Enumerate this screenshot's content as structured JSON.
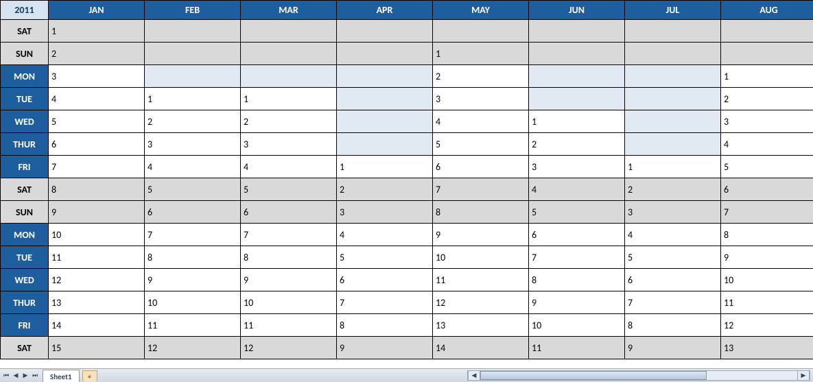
{
  "year": "2011",
  "months": [
    "JAN",
    "FEB",
    "MAR",
    "APR",
    "MAY",
    "JUN",
    "JUL",
    "AUG"
  ],
  "days": [
    "SAT",
    "SUN",
    "MON",
    "TUE",
    "WED",
    "THUR",
    "FRI",
    "SAT",
    "SUN",
    "MON",
    "TUE",
    "WED",
    "THUR",
    "FRI",
    "SAT"
  ],
  "weekend_flags": [
    true,
    true,
    false,
    false,
    false,
    false,
    false,
    true,
    true,
    false,
    false,
    false,
    false,
    false,
    true
  ],
  "grid": [
    [
      "1",
      "",
      "",
      "",
      "",
      "",
      "",
      ""
    ],
    [
      "2",
      "",
      "",
      "",
      "1",
      "",
      "",
      ""
    ],
    [
      "3",
      "",
      "",
      "",
      "2",
      "",
      "",
      "1"
    ],
    [
      "4",
      "1",
      "1",
      "",
      "3",
      "",
      "",
      "2"
    ],
    [
      "5",
      "2",
      "2",
      "",
      "4",
      "1",
      "",
      "3"
    ],
    [
      "6",
      "3",
      "3",
      "",
      "5",
      "2",
      "",
      "4"
    ],
    [
      "7",
      "4",
      "4",
      "1",
      "6",
      "3",
      "1",
      "5"
    ],
    [
      "8",
      "5",
      "5",
      "2",
      "7",
      "4",
      "2",
      "6"
    ],
    [
      "9",
      "6",
      "6",
      "3",
      "8",
      "5",
      "3",
      "7"
    ],
    [
      "10",
      "7",
      "7",
      "4",
      "9",
      "6",
      "4",
      "8"
    ],
    [
      "11",
      "8",
      "8",
      "5",
      "10",
      "7",
      "5",
      "9"
    ],
    [
      "12",
      "9",
      "9",
      "6",
      "11",
      "8",
      "6",
      "10"
    ],
    [
      "13",
      "10",
      "10",
      "7",
      "12",
      "9",
      "7",
      "11"
    ],
    [
      "14",
      "11",
      "11",
      "8",
      "13",
      "10",
      "8",
      "12"
    ],
    [
      "15",
      "12",
      "12",
      "9",
      "14",
      "11",
      "9",
      "13"
    ]
  ],
  "sheet_tab": "Sheet1",
  "colors": {
    "header_bg": "#1f5e9e",
    "header_fg": "#ffffff",
    "year_bg": "#d6e3f0",
    "weekend_bg": "#d9d9d9",
    "blank_bg": "#e1e9f3"
  }
}
